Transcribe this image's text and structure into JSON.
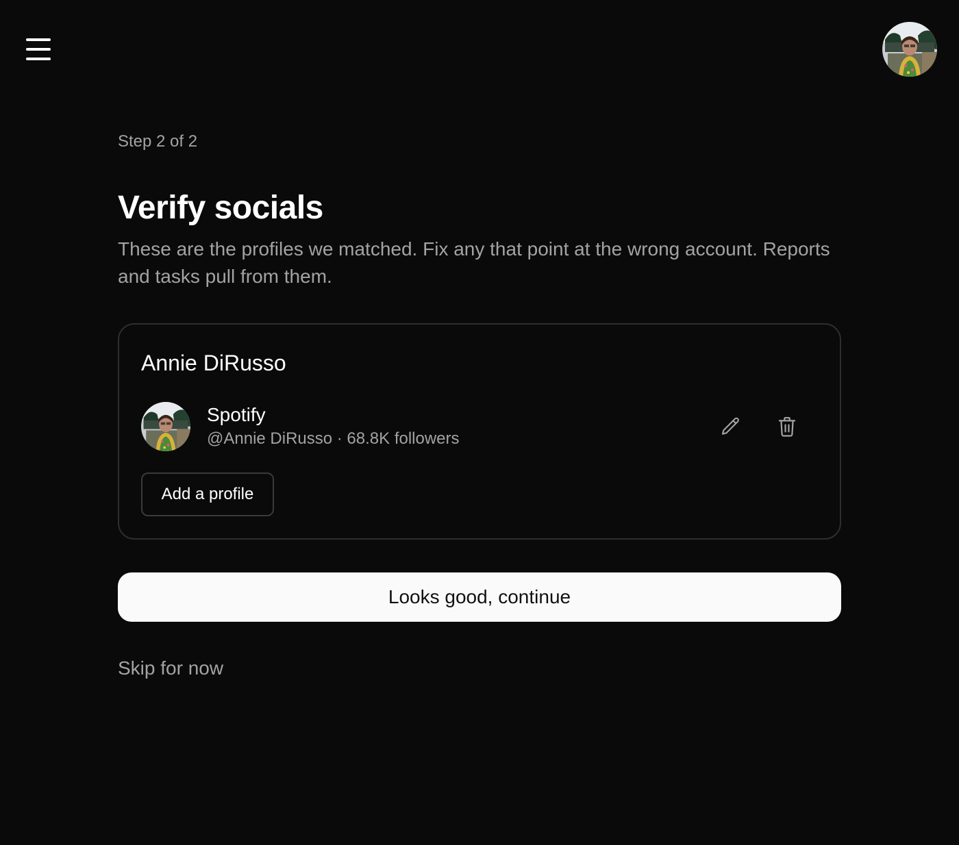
{
  "header": {
    "menu_icon": "hamburger-menu-icon",
    "avatar_icon": "user-avatar-photo"
  },
  "onboarding": {
    "step_label": "Step 2 of 2",
    "title": "Verify socials",
    "subtitle": "These are the profiles we matched. Fix any that point at the wrong account. Reports and tasks pull from them."
  },
  "card": {
    "name": "Annie DiRusso",
    "profiles": [
      {
        "platform": "Spotify",
        "handle": "@Annie DiRusso",
        "followers": "68.8K followers",
        "meta": "@Annie DiRusso · 68.8K followers",
        "edit_icon": "pencil-icon",
        "delete_icon": "trash-icon"
      }
    ],
    "add_label": "Add a profile"
  },
  "actions": {
    "continue_label": "Looks good, continue",
    "skip_label": "Skip for now"
  },
  "colors": {
    "background": "#0a0a0a",
    "muted_text": "#a3a3a3",
    "primary_button_bg": "#fafafa",
    "card_border": "#2e2e2e"
  }
}
